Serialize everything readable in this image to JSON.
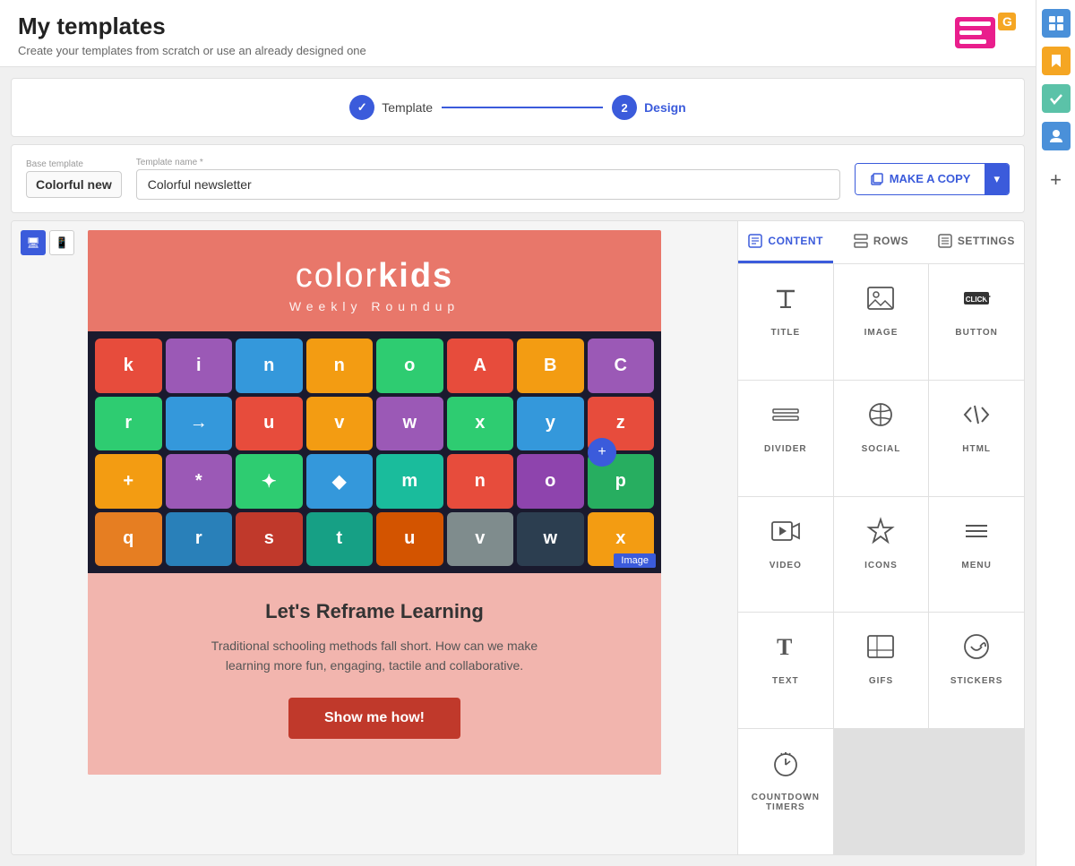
{
  "header": {
    "title": "My templates",
    "subtitle": "Create your templates from scratch or use an already designed one"
  },
  "stepper": {
    "step1_label": "Template",
    "step1_done": true,
    "step2_number": "2",
    "step2_label": "Design"
  },
  "template_bar": {
    "base_template_label": "Base template",
    "base_template_value": "Colorful new",
    "template_name_label": "Template name *",
    "template_name_value": "Colorful newsletter",
    "make_copy_label": "MAKE A COPY"
  },
  "canvas": {
    "desktop_icon": "🖥",
    "mobile_icon": "📱",
    "brand_name_light": "color",
    "brand_name_bold": "kids",
    "brand_subtitle": "Weekly Roundup",
    "body_heading": "Let's Reframe Learning",
    "body_text": "Traditional schooling methods fall short. How can we make learning more fun, engaging, tactile and collaborative.",
    "cta_label": "Show me how!",
    "image_label": "Image",
    "drag_plus": "+"
  },
  "panel": {
    "tabs": [
      {
        "id": "content",
        "label": "CONTENT",
        "active": true
      },
      {
        "id": "rows",
        "label": "ROWS",
        "active": false
      },
      {
        "id": "settings",
        "label": "SETTINGS",
        "active": false
      }
    ],
    "content_items": [
      {
        "id": "title",
        "label": "TITLE"
      },
      {
        "id": "image",
        "label": "IMAGE"
      },
      {
        "id": "button",
        "label": "BUTTON"
      },
      {
        "id": "divider",
        "label": "DIVIDER"
      },
      {
        "id": "social",
        "label": "SOCIAL"
      },
      {
        "id": "html",
        "label": "HTML"
      },
      {
        "id": "video",
        "label": "VIDEO"
      },
      {
        "id": "icons",
        "label": "ICONS"
      },
      {
        "id": "menu",
        "label": "MENU"
      },
      {
        "id": "text",
        "label": "TEXT"
      },
      {
        "id": "gifs",
        "label": "GIFS"
      },
      {
        "id": "stickers",
        "label": "STICKERS"
      },
      {
        "id": "countdown",
        "label": "COUNTDOWN\nTIMERS"
      }
    ]
  },
  "right_sidebar": {
    "icons": [
      "grid",
      "bookmark",
      "check",
      "person",
      "plus"
    ]
  },
  "colors": {
    "accent": "#3b5bdb",
    "brand_bg": "#e8776a",
    "body_bg": "#f2b5ae",
    "cta": "#c0392b"
  }
}
